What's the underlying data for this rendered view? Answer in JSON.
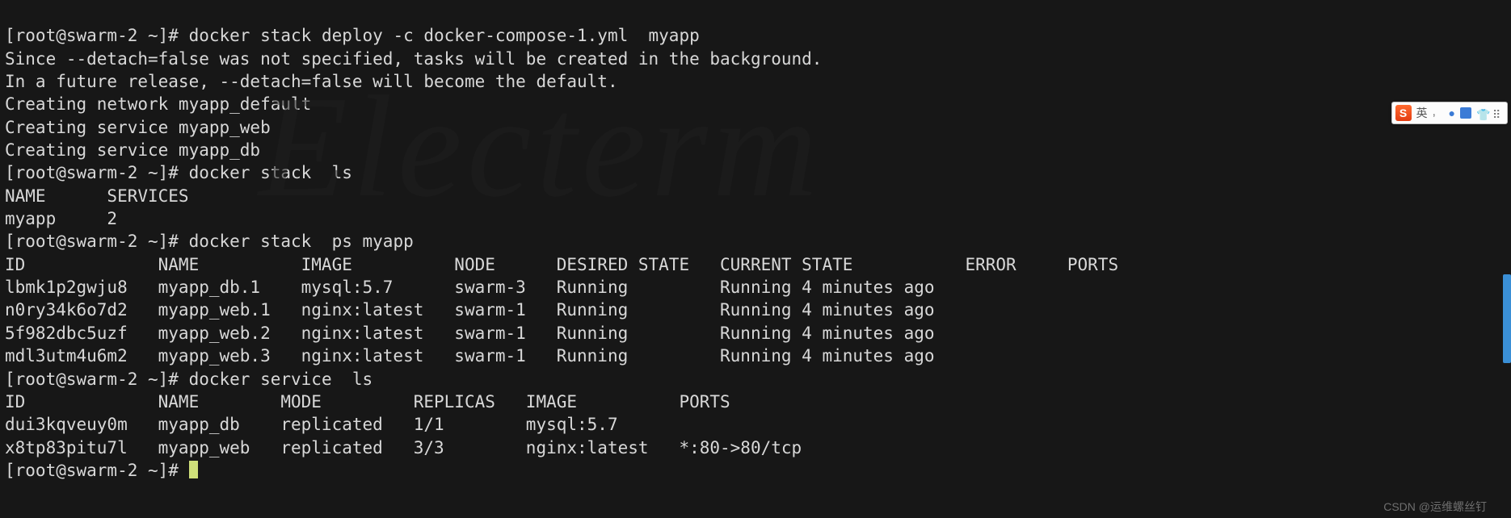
{
  "watermark_bg": "Electerm",
  "csdn_watermark": "CSDN @运维螺丝钉",
  "ime": {
    "s": "S",
    "lang": "英",
    "comma": ",",
    "mic": "●",
    "kbd": "▦",
    "shirt": "▼",
    "grid": "⁞⁞"
  },
  "prompt": "[root@swarm-2 ~]# ",
  "cmd1": "docker stack deploy -c docker-compose-1.yml  myapp",
  "out1_l1": "Since --detach=false was not specified, tasks will be created in the background.",
  "out1_l2": "In a future release, --detach=false will become the default.",
  "out1_l3": "Creating network myapp_default",
  "out1_l4": "Creating service myapp_web",
  "out1_l5": "Creating service myapp_db",
  "cmd2": "docker stack  ls",
  "stack_ls_header": "NAME      SERVICES",
  "stack_ls_row": "myapp     2",
  "cmd3": "docker stack  ps myapp",
  "ps_header": "ID             NAME          IMAGE          NODE      DESIRED STATE   CURRENT STATE           ERROR     PORTS",
  "ps_r1": "lbmk1p2gwju8   myapp_db.1    mysql:5.7      swarm-3   Running         Running 4 minutes ago             ",
  "ps_r2": "n0ry34k6o7d2   myapp_web.1   nginx:latest   swarm-1   Running         Running 4 minutes ago             ",
  "ps_r3": "5f982dbc5uzf   myapp_web.2   nginx:latest   swarm-1   Running         Running 4 minutes ago             ",
  "ps_r4": "mdl3utm4u6m2   myapp_web.3   nginx:latest   swarm-1   Running         Running 4 minutes ago             ",
  "cmd4": "docker service  ls",
  "svc_header": "ID             NAME        MODE         REPLICAS   IMAGE          PORTS",
  "svc_r1": "dui3kqveuy0m   myapp_db    replicated   1/1        mysql:5.7      ",
  "svc_r2": "x8tp83pitu7l   myapp_web   replicated   3/3        nginx:latest   *:80->80/tcp",
  "prompt_last": "[root@swarm-2 ~]# ",
  "chart_data": {
    "type": "table",
    "tables": [
      {
        "title": "docker stack ls",
        "columns": [
          "NAME",
          "SERVICES"
        ],
        "rows": [
          [
            "myapp",
            "2"
          ]
        ]
      },
      {
        "title": "docker stack ps myapp",
        "columns": [
          "ID",
          "NAME",
          "IMAGE",
          "NODE",
          "DESIRED STATE",
          "CURRENT STATE",
          "ERROR",
          "PORTS"
        ],
        "rows": [
          [
            "lbmk1p2gwju8",
            "myapp_db.1",
            "mysql:5.7",
            "swarm-3",
            "Running",
            "Running 4 minutes ago",
            "",
            ""
          ],
          [
            "n0ry34k6o7d2",
            "myapp_web.1",
            "nginx:latest",
            "swarm-1",
            "Running",
            "Running 4 minutes ago",
            "",
            ""
          ],
          [
            "5f982dbc5uzf",
            "myapp_web.2",
            "nginx:latest",
            "swarm-1",
            "Running",
            "Running 4 minutes ago",
            "",
            ""
          ],
          [
            "mdl3utm4u6m2",
            "myapp_web.3",
            "nginx:latest",
            "swarm-1",
            "Running",
            "Running 4 minutes ago",
            "",
            ""
          ]
        ]
      },
      {
        "title": "docker service ls",
        "columns": [
          "ID",
          "NAME",
          "MODE",
          "REPLICAS",
          "IMAGE",
          "PORTS"
        ],
        "rows": [
          [
            "dui3kqveuy0m",
            "myapp_db",
            "replicated",
            "1/1",
            "mysql:5.7",
            ""
          ],
          [
            "x8tp83pitu7l",
            "myapp_web",
            "replicated",
            "3/3",
            "nginx:latest",
            "*:80->80/tcp"
          ]
        ]
      }
    ]
  }
}
